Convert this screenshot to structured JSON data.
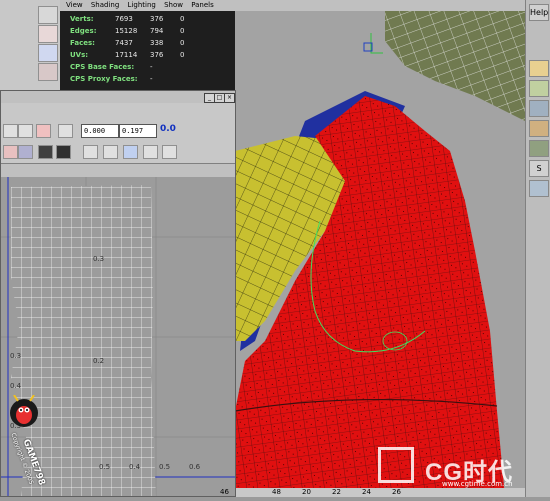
{
  "menu": {
    "items": [
      "View",
      "Shading",
      "Lighting",
      "Show",
      "Panels"
    ],
    "help": "Help"
  },
  "hud": {
    "rows": [
      {
        "label": "Verts:",
        "v1": "7693",
        "v2": "376",
        "v3": "0"
      },
      {
        "label": "Edges:",
        "v1": "15128",
        "v2": "794",
        "v3": "0"
      },
      {
        "label": "Faces:",
        "v1": "7437",
        "v2": "338",
        "v3": "0"
      },
      {
        "label": "UVs:",
        "v1": "17114",
        "v3": "0",
        "v2": "376"
      },
      {
        "label": "CPS Base Faces:",
        "v1": "-",
        "v2": "",
        "v3": ""
      },
      {
        "label": "CPS Proxy Faces:",
        "v1": "-",
        "v2": "",
        "v3": ""
      }
    ]
  },
  "uv_editor": {
    "u_value": "0.000",
    "v_value": "0.197",
    "status_value": "0.0",
    "coords": [
      "0.3",
      "0.2",
      "0.3",
      "0.4",
      "0.5"
    ],
    "bottom_labels": [
      "0.5",
      "0.4",
      "0.5",
      "0.6"
    ]
  },
  "timeline": {
    "frames": [
      "46",
      "48",
      "20",
      "22",
      "24",
      "26"
    ]
  },
  "watermark": {
    "game": "GAME798",
    "copyright": "Copyright © 2005",
    "cg_logo": "CG时代",
    "url": "www.cgtime.com.cn"
  },
  "colors": {
    "mesh_red": "#e01010",
    "mesh_yellow": "#c8c030",
    "mesh_blue": "#2030a0",
    "wire": "#203060",
    "hud_label": "#7fe07f"
  }
}
